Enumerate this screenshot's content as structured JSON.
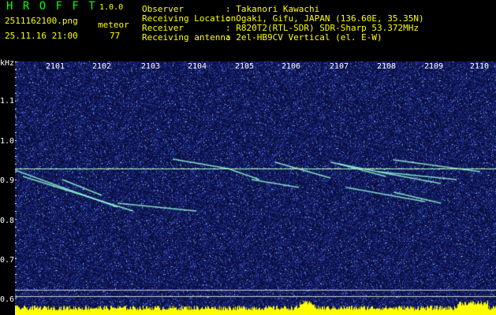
{
  "header": {
    "app_title": "H R O F F T",
    "version": "1.0.0",
    "filename": "2511162100.png",
    "mode": "meteor",
    "datetime": "25.11.16 21:00",
    "count": "77"
  },
  "info": {
    "observer_label": "Observer",
    "observer_value": ": Takanori Kawachi",
    "location_label": "Receiving Location",
    "location_value": ": Ogaki, Gifu, JAPAN (136.60E, 35.35N)",
    "receiver_label": "Receiver",
    "receiver_value": ": R820T2(RTL-SDR) SDR-Sharp 53.372MHz",
    "antenna_label": "Receiving antenna",
    "antenna_value": ": 2el-HB9CV Vertical (el. E-W)"
  },
  "plot": {
    "y_unit": "kHz",
    "y_ticks": [
      "1.1",
      "1.0",
      "0.9",
      "0.8",
      "0.7",
      "0.6"
    ],
    "x_ticks": [
      "2101",
      "2102",
      "2103",
      "2104",
      "2105",
      "2106",
      "2107",
      "2108",
      "2109",
      "2110"
    ],
    "carrier_khz": 0.91,
    "colors": {
      "background": "#0a0f3c",
      "carrier": "#a0ffd0",
      "axis": "#ffffff",
      "amplitude": "#ffff00"
    }
  }
}
